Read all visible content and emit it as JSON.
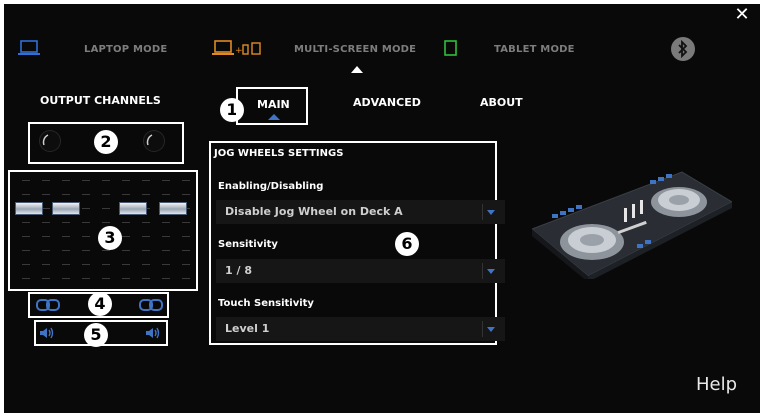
{
  "window": {
    "close_glyph": "✕"
  },
  "modes": [
    {
      "label": "LAPTOP MODE",
      "icon": "laptop-icon"
    },
    {
      "label": "MULTI-SCREEN MODE",
      "icon": "multi-screen-icon",
      "selected": true
    },
    {
      "label": "TABLET MODE",
      "icon": "tablet-icon"
    }
  ],
  "bluetooth": {
    "icon": "bluetooth-icon",
    "glyph": "ᛒ"
  },
  "output_channels": {
    "title": "OUTPUT CHANNELS"
  },
  "tabs": [
    {
      "label": "MAIN",
      "selected": true
    },
    {
      "label": "ADVANCED"
    },
    {
      "label": "ABOUT"
    }
  ],
  "callouts": {
    "n1": "1",
    "n2": "2",
    "n3": "3",
    "n4": "4",
    "n5": "5",
    "n6": "6"
  },
  "jog_settings": {
    "title": "JOG WHEELS SETTINGS",
    "enabling_label": "Enabling/Disabling",
    "enabling_value": "Disable Jog Wheel on Deck A",
    "sensitivity_label": "Sensitivity",
    "sensitivity_value": "1 / 8",
    "touch_label": "Touch Sensitivity",
    "touch_value": "Level 1"
  },
  "help": {
    "label": "Help"
  },
  "colors": {
    "accent_blue": "#3f74c4",
    "laptop_blue": "#2f6fd6",
    "multi_orange": "#e08a22",
    "tablet_green": "#2fbf3a"
  }
}
